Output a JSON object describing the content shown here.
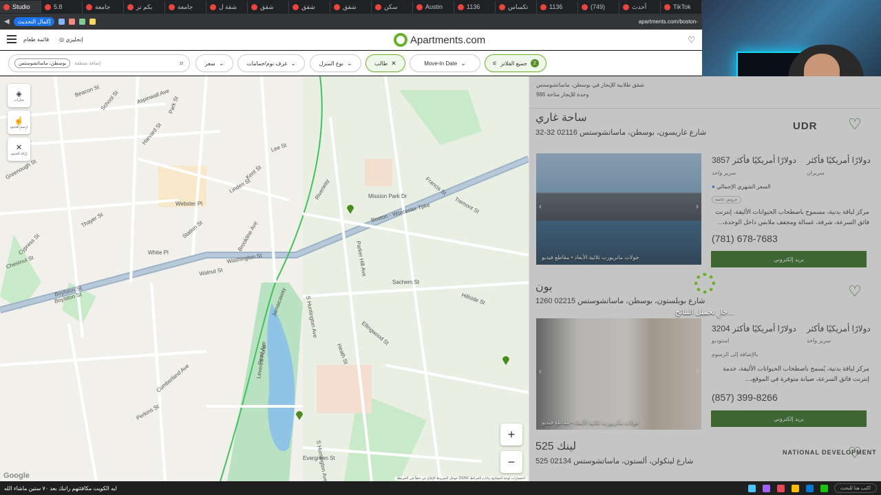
{
  "browser": {
    "tabs": [
      {
        "label": "Studio"
      },
      {
        "label": "5.8"
      },
      {
        "label": "جامعة"
      },
      {
        "label": "بكم تر"
      },
      {
        "label": "جامعة"
      },
      {
        "label": "شقة ل"
      },
      {
        "label": "شقق"
      },
      {
        "label": "شقق"
      },
      {
        "label": "شقق"
      },
      {
        "label": "سكن"
      },
      {
        "label": "Austin"
      },
      {
        "label": "1136"
      },
      {
        "label": "تكساس"
      },
      {
        "label": "1136"
      },
      {
        "label": "(749)"
      },
      {
        "label": "أحدث"
      },
      {
        "label": "TikTok"
      }
    ],
    "update_label": "إكمال التحديث",
    "url": "apartments.com/boston-"
  },
  "header": {
    "menu_label": "قائمة طعام",
    "language_label": "إنجليزي",
    "logo_text": "Apartments.com",
    "heart_icon": "heart-icon"
  },
  "filters": {
    "location_chip": "بوسطن، ماساتشوستس",
    "search_placeholder": "إضافة منطقة",
    "price": "سعر",
    "beds_baths": "غرف نوم/حمامات",
    "home_type": "نوع المنزل",
    "student": "طالب",
    "move_in": "Move-In Date",
    "all_filters": "جميع الفلاتر",
    "all_filters_count": "2"
  },
  "map": {
    "tools": [
      {
        "label": "جبارات",
        "icon": "layers-icon"
      },
      {
        "label": "ارسم الحدود",
        "icon": "draw-icon"
      },
      {
        "label": "إزالة الحدود",
        "icon": "close-icon"
      }
    ],
    "zoom_in": "+",
    "zoom_out": "−",
    "google": "Google",
    "attribution": "اختصارات لوحة المفاتيح  بيانات الخرائط ©2025 جوجل  الشروط  الإبلاغ عن خطأ في الخريطة",
    "streets": [
      "Washington St",
      "Boylston St",
      "Boston - Worcester Tpke",
      "Riverway",
      "Jamaicaway",
      "S Huntington Ave",
      "Heath St",
      "Pond Ave",
      "Chestnut St",
      "Aspinwall Ave",
      "Harvard St",
      "School St",
      "Kent St",
      "Webster Pl",
      "Station St",
      "Cypress St",
      "Walnut St",
      "Francis St",
      "Tremont St",
      "Parker Hill Ave",
      "Sachem St",
      "Hillside St",
      "Lee St",
      "Evergreen St",
      "Greenough St",
      "Boylston St",
      "Perkins St",
      "Cumberland Ave",
      "Mission Park Dr",
      "Leverett Pond",
      "S Huntington Ave",
      "Ellingwood St",
      "Linden St",
      "Park St",
      "Brookline Ave",
      "Beacon St",
      "Thayer St",
      "White Pl"
    ]
  },
  "listings": {
    "title": "شقق طلابية للإيجار في بوسطن، ماساتشوستس",
    "count": "986 وحدة للإيجار متاحة",
    "cards": [
      {
        "name": "ساحة غاري",
        "address": "32-32 شارع غاريسون، بوسطن، ماساتشوستس 02116",
        "brand": "UDR",
        "price1": "3857 دولارًا أمريكيًا فأكثر",
        "price1_type": "سرير واحد",
        "price2": "دولارًا أمريكيًا فأكثر",
        "price2_type": "سريران",
        "monthly": "السعر الشهري الإجمالي",
        "badge": "عروض خاصة",
        "photo_caption": "جولات ماتربورت ثلاثية الأبعاد • مقاطع فيديو",
        "amenities": "مركز لياقة بدنية، مسموح باصطحاب الحيوانات الأليفة، إنترنت فائق السرعة، شرفة، غسالة ومجفف ملابس داخل الوحدة،...",
        "phone": "(781) 678-7683",
        "email": "بريد إلكتروني"
      },
      {
        "name": "بون",
        "address": "1260 شارع بويلستون، بوسطن، ماساتشوستس 02215",
        "brand": "",
        "price1": "3204 دولارًا أمريكيًا فأكثر",
        "price1_type": "استوديو",
        "price2": "دولارًا أمريكيًا فأكثر",
        "price2_type": "سرير واحد",
        "fees": "بالإضافة إلى الرسوم",
        "photo_caption": "جولات ماتربورت ثلاثية الأبعاد • مقاطع فيديو",
        "amenities": "مركز لياقة بدنية، يُسمح باصطحاب الحيوانات الأليفة، خدمة إنترنت فائق السرعة، صيانة متوفرة في الموقع،...",
        "phone": "(857) 399-8266",
        "email": "بريد إلكتروني"
      },
      {
        "name": "525 لينك",
        "address": "525 شارع لينكولن، ألستون، ماساتشوستس 02134",
        "brand": "NATIONAL DEVELOPMENT"
      }
    ],
    "loading_text": "جارٍ تحميل النتائج..."
  },
  "taskbar": {
    "news": "ايه الكويت مكافئتهم راتبك بعد ٧٠ ستين ماشاء الله",
    "search_placeholder": "اكتب هنا للبحث"
  }
}
